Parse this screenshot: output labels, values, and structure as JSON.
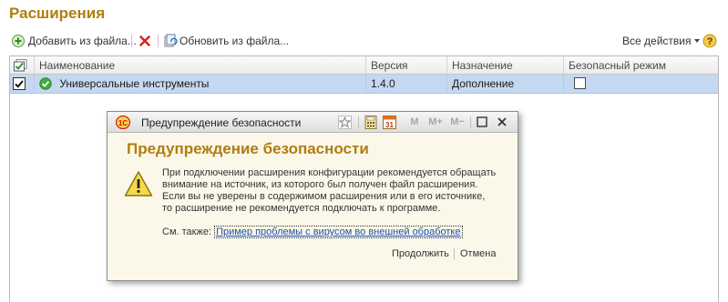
{
  "page": {
    "title": "Расширения"
  },
  "toolbar": {
    "add_label": "Добавить из файла...",
    "update_label": "Обновить из файла...",
    "all_actions_label": "Все действия",
    "icons": {
      "add": "plus-circle-icon",
      "delete": "red-x-icon",
      "update": "update-from-file-icon",
      "dropdown": "caret-down-icon",
      "help": "help-question-icon"
    }
  },
  "grid": {
    "columns": [
      "Наименование",
      "Версия",
      "Назначение",
      "Безопасный режим"
    ],
    "rows": [
      {
        "name": "Универсальные инструменты",
        "version": "1.4.0",
        "purpose": "Дополнение",
        "checked": true,
        "safe_mode": false
      }
    ]
  },
  "dialog": {
    "window_title": "Предупреждение безопасности",
    "heading": "Предупреждение безопасности",
    "message": "При подключении расширения конфигурации рекомендуется обращать\nвнимание на источник, из которого был получен файл расширения.\nЕсли вы не уверены в содержимом расширения или в его источнике,\nто расширение не рекомендуется подключать к программе.",
    "see_also_label": "См. также:",
    "link_text": "Пример проблемы с вирусом во внешней обработке",
    "continue_label": "Продолжить",
    "cancel_label": "Отмена",
    "title_icons": {
      "app": "1c-logo-icon",
      "favorite": "star-icon",
      "calculator": "calculator-icon",
      "calendar": "calendar-icon",
      "memory": [
        "M",
        "M+",
        "M−"
      ]
    },
    "calendar_day": "31",
    "warning_icon": "warning-triangle-icon"
  },
  "colors": {
    "accent": "#b07d0f",
    "selection": "#c5d8f1",
    "link": "#1f4fa5",
    "dialog_bg": "#fbf8ea"
  }
}
